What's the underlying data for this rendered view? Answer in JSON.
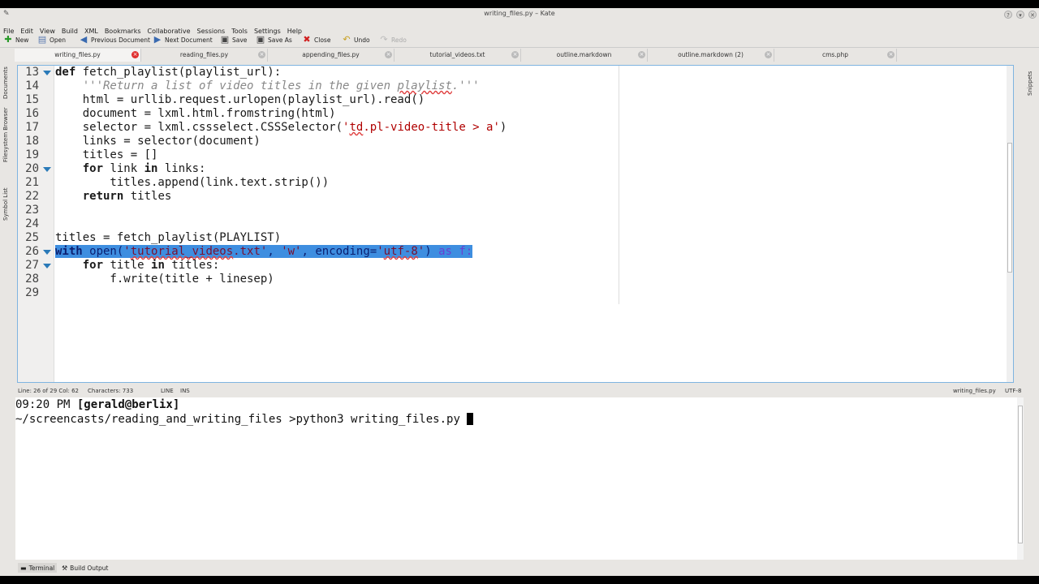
{
  "window": {
    "title": "writing_files.py – Kate"
  },
  "menu": [
    "File",
    "Edit",
    "View",
    "Build",
    "XML",
    "Bookmarks",
    "Collaborative",
    "Sessions",
    "Tools",
    "Settings",
    "Help"
  ],
  "toolbar": {
    "new": "New",
    "open": "Open",
    "previous": "Previous Document",
    "next": "Next Document",
    "save": "Save",
    "save_as": "Save As",
    "close": "Close",
    "undo": "Undo",
    "redo": "Redo"
  },
  "tabs": [
    "writing_files.py",
    "reading_files.py",
    "appending_files.py",
    "tutorial_videos.txt",
    "outline.markdown",
    "outline.markdown (2)",
    "cms.php"
  ],
  "side_left": [
    "Documents",
    "Filesystem Browser",
    "Symbol List"
  ],
  "side_right": [
    "Snippets"
  ],
  "code": {
    "line_numbers": [
      "13",
      "14",
      "15",
      "16",
      "17",
      "18",
      "19",
      "20",
      "21",
      "22",
      "23",
      "24",
      "25",
      "26",
      "27",
      "28",
      "29"
    ],
    "l13_kw": "def",
    "l13_rest": " fetch_playlist(playlist_url):",
    "l14_a": "    '''Return a list of video titles in the given ",
    "l14_b": "playlist",
    "l14_c": ".'''",
    "l15": "    html = urllib.request.urlopen(playlist_url).read()",
    "l16": "    document = lxml.html.fromstring(html)",
    "l17_a": "    selector = lxml.cssselect.CSSSelector(",
    "l17_b": "'",
    "l17_c": "td",
    "l17_d": ".pl-video-title > a'",
    "l17_e": ")",
    "l18": "    links = selector(document)",
    "l19": "    titles = []",
    "l20_a": "    ",
    "l20_kw1": "for",
    "l20_b": " link ",
    "l20_kw2": "in",
    "l20_c": " links:",
    "l21": "        titles.append(link.text.strip())",
    "l22_a": "    ",
    "l22_kw": "return",
    "l22_b": " titles",
    "l25": "titles = fetch_playlist(PLAYLIST)",
    "l26_kw": "with",
    "l26_a": " open(",
    "l26_b": "'",
    "l26_c": "tutorial_videos",
    "l26_d": ".txt'",
    "l26_e": ", ",
    "l26_f": "'w'",
    "l26_g": ", encoding=",
    "l26_h": "'",
    "l26_i": "utf-8",
    "l26_j": "'",
    "l26_k": ") ",
    "l26_as": "as",
    "l26_l": " f:",
    "l27_a": "    ",
    "l27_kw1": "for",
    "l27_b": " title ",
    "l27_kw2": "in",
    "l27_c": " titles:",
    "l28": "        f.write(title + linesep)"
  },
  "status": {
    "position": "Line: 26 of 29 Col: 62",
    "characters": "Characters: 733",
    "line_mode": "LINE",
    "ins": "INS",
    "filename": "writing_files.py",
    "encoding": "UTF-8"
  },
  "terminal": {
    "time": "09:20 PM ",
    "user": "[gerald@berlix]",
    "command": "~/screencasts/reading_and_writing_files >python3 writing_files.py "
  },
  "bottom_tabs": {
    "terminal": "Terminal",
    "build": "Build Output"
  }
}
